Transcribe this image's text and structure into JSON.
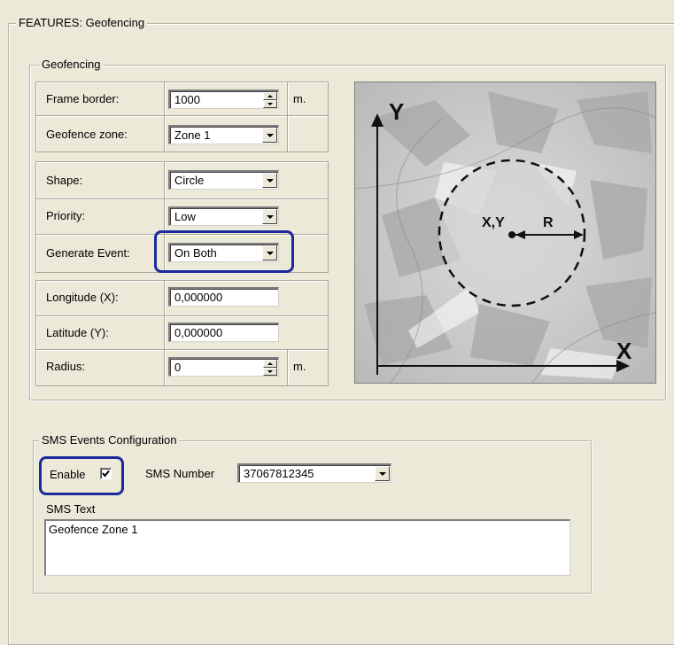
{
  "features_group": {
    "title": "FEATURES: Geofencing"
  },
  "geofencing_group": {
    "title": "Geofencing",
    "frame_border": {
      "label": "Frame border:",
      "value": "1000",
      "unit": "m."
    },
    "geofence_zone": {
      "label": "Geofence zone:",
      "value": "Zone 1"
    },
    "shape": {
      "label": "Shape:",
      "value": "Circle"
    },
    "priority": {
      "label": "Priority:",
      "value": "Low"
    },
    "generate_event": {
      "label": "Generate Event:",
      "value": "On Both"
    },
    "longitude": {
      "label": "Longitude (X):",
      "value": "0,000000"
    },
    "latitude": {
      "label": "Latitude (Y):",
      "value": "0,000000"
    },
    "radius": {
      "label": "Radius:",
      "value": "0",
      "unit": "m."
    }
  },
  "diagram": {
    "axis_y": "Y",
    "axis_x": "X",
    "center_label": "X,Y",
    "radius_label": "R"
  },
  "sms_group": {
    "title": "SMS Events Configuration",
    "enable_label": "Enable",
    "enable_checked": true,
    "sms_number_label": "SMS Number",
    "sms_number_value": "37067812345",
    "sms_text_label": "SMS Text",
    "sms_text_value": "Geofence Zone 1"
  },
  "colors": {
    "background": "#ece9d8",
    "highlight": "#1c2a9c"
  }
}
